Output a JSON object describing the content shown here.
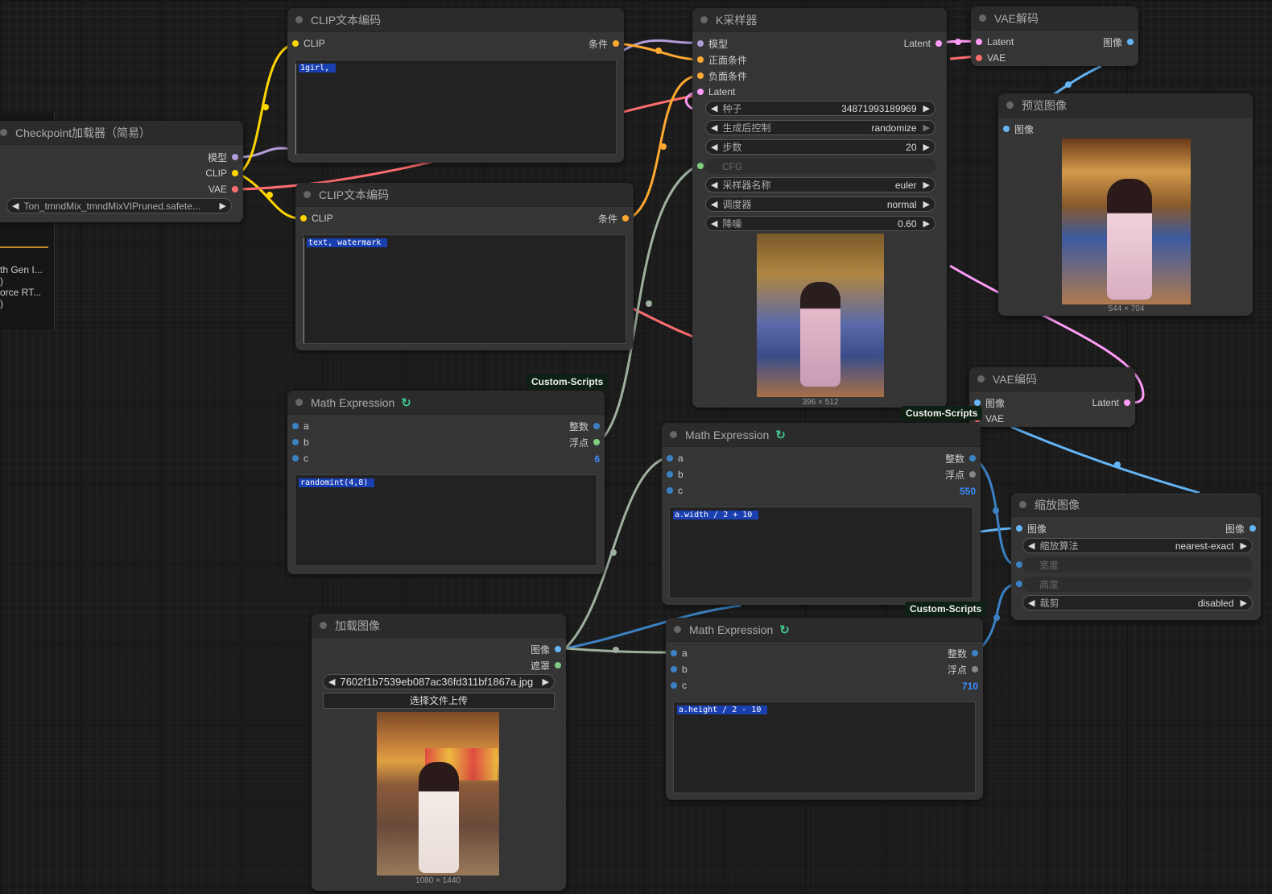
{
  "colors": {
    "model": "#b39ddb",
    "clip": "#ffd500",
    "vae": "#ff6e6e",
    "cond": "#ffa931",
    "latent": "#ff9cf9",
    "image": "#64b5f6",
    "float": "#7fd07f",
    "int": "#3b82c4",
    "mask": "#81c784"
  },
  "checkpoint": {
    "title": "Checkpoint加载器（简易）",
    "out_model": "模型",
    "out_clip": "CLIP",
    "out_vae": "VAE",
    "ckpt_name": "Ton_tmndMix_tmndMixVIPruned.safete...",
    "side_text_1": "th Gen I...",
    "side_text_2": ")",
    "side_text_3": "orce RT...",
    "side_text_4": ")"
  },
  "clip_pos": {
    "title": "CLIP文本编码",
    "in_clip": "CLIP",
    "out_cond": "条件",
    "text": "1girl,"
  },
  "clip_neg": {
    "title": "CLIP文本编码",
    "in_clip": "CLIP",
    "out_cond": "条件",
    "text": "text, watermark"
  },
  "ksampler": {
    "title": "K采样器",
    "in_model": "模型",
    "in_pos": "正面条件",
    "in_neg": "负面条件",
    "in_latent": "Latent",
    "out_latent": "Latent",
    "seed_label": "种子",
    "seed_value": "34871993189969",
    "control_label": "生成后控制",
    "control_value": "randomize",
    "steps_label": "步数",
    "steps_value": "20",
    "cfg_label": "CFG",
    "sampler_label": "采样器名称",
    "sampler_value": "euler",
    "scheduler_label": "调度器",
    "scheduler_value": "normal",
    "denoise_label": "降噪",
    "denoise_value": "0.60",
    "preview_dims": "396 × 512"
  },
  "vae_decode": {
    "title": "VAE解码",
    "in_latent": "Latent",
    "in_vae": "VAE",
    "out_image": "图像"
  },
  "preview": {
    "title": "预览图像",
    "in_image": "图像",
    "dims": "544 × 704"
  },
  "vae_encode": {
    "title": "VAE编码",
    "in_image": "图像",
    "in_vae": "VAE",
    "out_latent": "Latent"
  },
  "math1": {
    "badge": "Custom-Scripts",
    "title": "Math Expression",
    "in_a": "a",
    "in_b": "b",
    "in_c": "c",
    "out_int": "整数",
    "out_float": "浮点",
    "result": "6",
    "expr": "randomint(4,8)"
  },
  "math2": {
    "badge": "Custom-Scripts",
    "title": "Math Expression",
    "in_a": "a",
    "in_b": "b",
    "in_c": "c",
    "out_int": "整数",
    "out_float": "浮点",
    "result": "550",
    "expr": "a.width / 2 + 10"
  },
  "math3": {
    "badge": "Custom-Scripts",
    "title": "Math Expression",
    "in_a": "a",
    "in_b": "b",
    "in_c": "c",
    "out_int": "整数",
    "out_float": "浮点",
    "result": "710",
    "expr": "a.height / 2 - 10"
  },
  "load_image": {
    "title": "加载图像",
    "out_image": "图像",
    "out_mask": "遮罩",
    "file": "7602f1b7539eb087ac36fd311bf1867a.jpg",
    "upload": "选择文件上传",
    "dims": "1080 × 1440"
  },
  "scale": {
    "title": "缩放图像",
    "in_image": "图像",
    "out_image": "图像",
    "method_label": "缩放算法",
    "method_value": "nearest-exact",
    "width_label": "宽度",
    "height_label": "高度",
    "crop_label": "裁剪",
    "crop_value": "disabled"
  }
}
